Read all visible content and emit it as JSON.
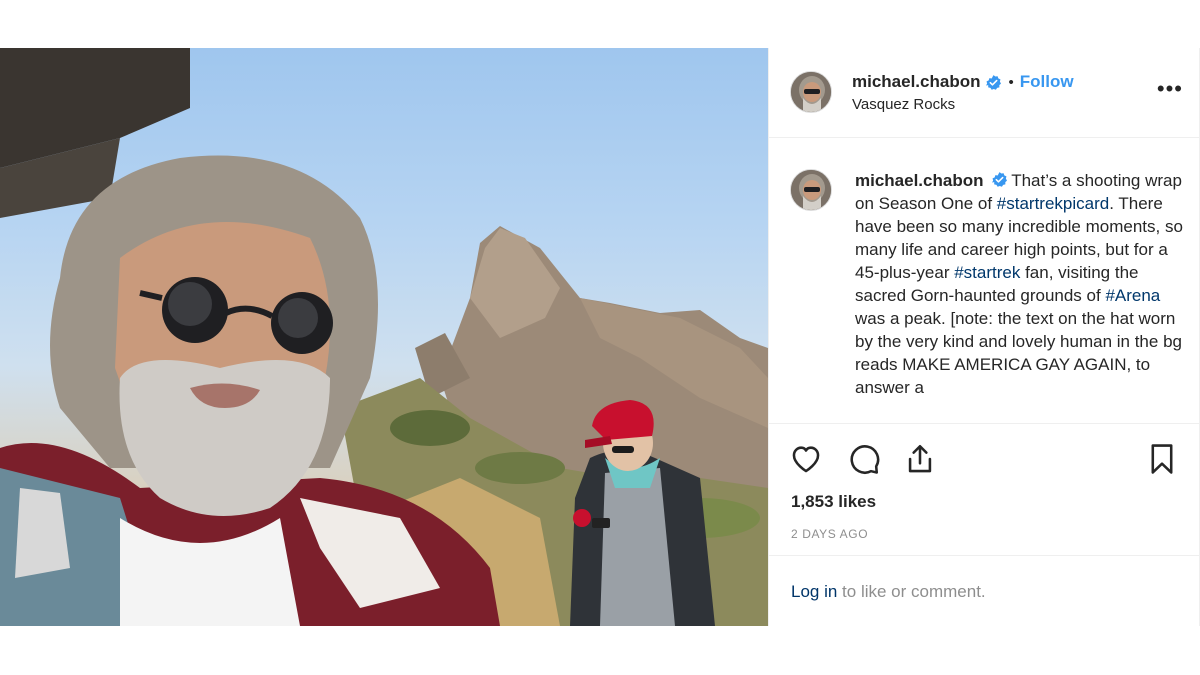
{
  "post": {
    "image_alt": "Selfie of a man with sunglasses and grey beard in front of rock formations; a person in a red cap looks at a phone behind him",
    "header": {
      "username": "michael.chabon",
      "verified": true,
      "separator": "•",
      "follow_label": "Follow",
      "location": "Vasquez Rocks",
      "more_icon": "more-options-icon"
    },
    "caption": {
      "username": "michael.chabon",
      "parts": [
        {
          "text": "That’s a shooting wrap on Season One of "
        },
        {
          "tag": "#startrekpicard"
        },
        {
          "text": ". There have been so many incredible moments, so many life and career high points, but for a 45-plus-year "
        },
        {
          "tag": "#startrek"
        },
        {
          "text": " fan, visiting the sacred Gorn-haunted grounds of "
        },
        {
          "tag": "#Arena"
        },
        {
          "text": " was a peak. [note: the text on the hat worn by the very kind and lovely human in the bg reads MAKE AMERICA GAY AGAIN, to answer a"
        }
      ]
    },
    "actions": {
      "like_icon": "heart-icon",
      "comment_icon": "comment-icon",
      "share_icon": "share-icon",
      "save_icon": "bookmark-icon"
    },
    "likes": "1,853 likes",
    "timestamp": "2 DAYS AGO",
    "comment_prompt": {
      "login_label": "Log in",
      "rest": " to like or comment."
    },
    "colors": {
      "link_blue": "#3897f0",
      "hashtag": "#00376b",
      "muted": "#8e8e8e",
      "verified_badge": "#3897f0"
    }
  }
}
